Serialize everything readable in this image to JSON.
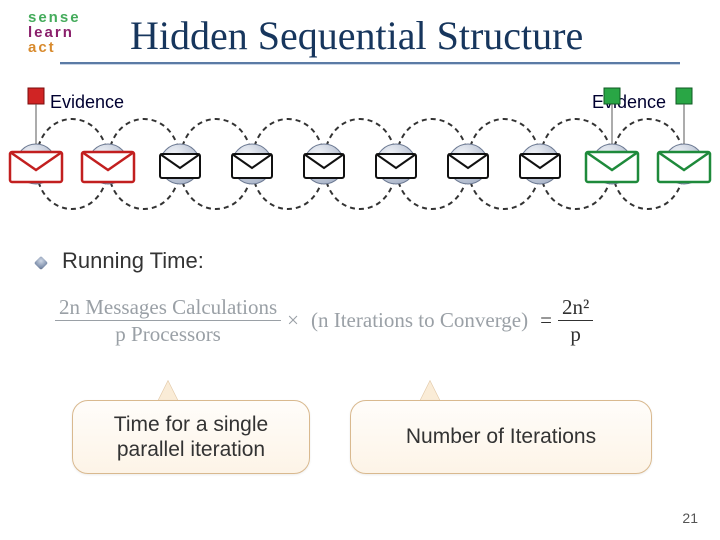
{
  "logo": {
    "line1": "sense",
    "line2": "learn",
    "line3": "act"
  },
  "title": "Hidden Sequential Structure",
  "labels": {
    "evidence_left": "Evidence",
    "evidence_right": "Evidence"
  },
  "section": {
    "heading": "Running Time:"
  },
  "formula": {
    "frac1_num": "2n Messages Calculations",
    "frac1_den": "p Processors",
    "times": "×",
    "mid": "(n Iterations to Converge)",
    "equals": "=",
    "frac2_num": "2n²",
    "frac2_den": "p"
  },
  "callouts": {
    "left_line1": "Time for a single",
    "left_line2": "parallel iteration",
    "right": "Number of Iterations"
  },
  "slide_number": "21",
  "chart_data": {
    "type": "diagram",
    "description": "Chain of 10 circular nodes connected by a horizontal line with dashed message-passing arcs looping between neighbors. Nodes 1–2 have red evidence boxes above and red envelope messages; nodes 3–8 have black envelope messages and gray boxes; nodes 9–10 have green evidence boxes above and green envelope messages. Bidirectional by symmetric arcs.",
    "node_count": 10,
    "evidence_colors": [
      "red",
      "red",
      "gray",
      "gray",
      "gray",
      "gray",
      "gray",
      "gray",
      "green",
      "green"
    ],
    "envelope_colors": [
      "red",
      "red",
      "black",
      "black",
      "black",
      "black",
      "black",
      "black",
      "green",
      "green"
    ]
  }
}
